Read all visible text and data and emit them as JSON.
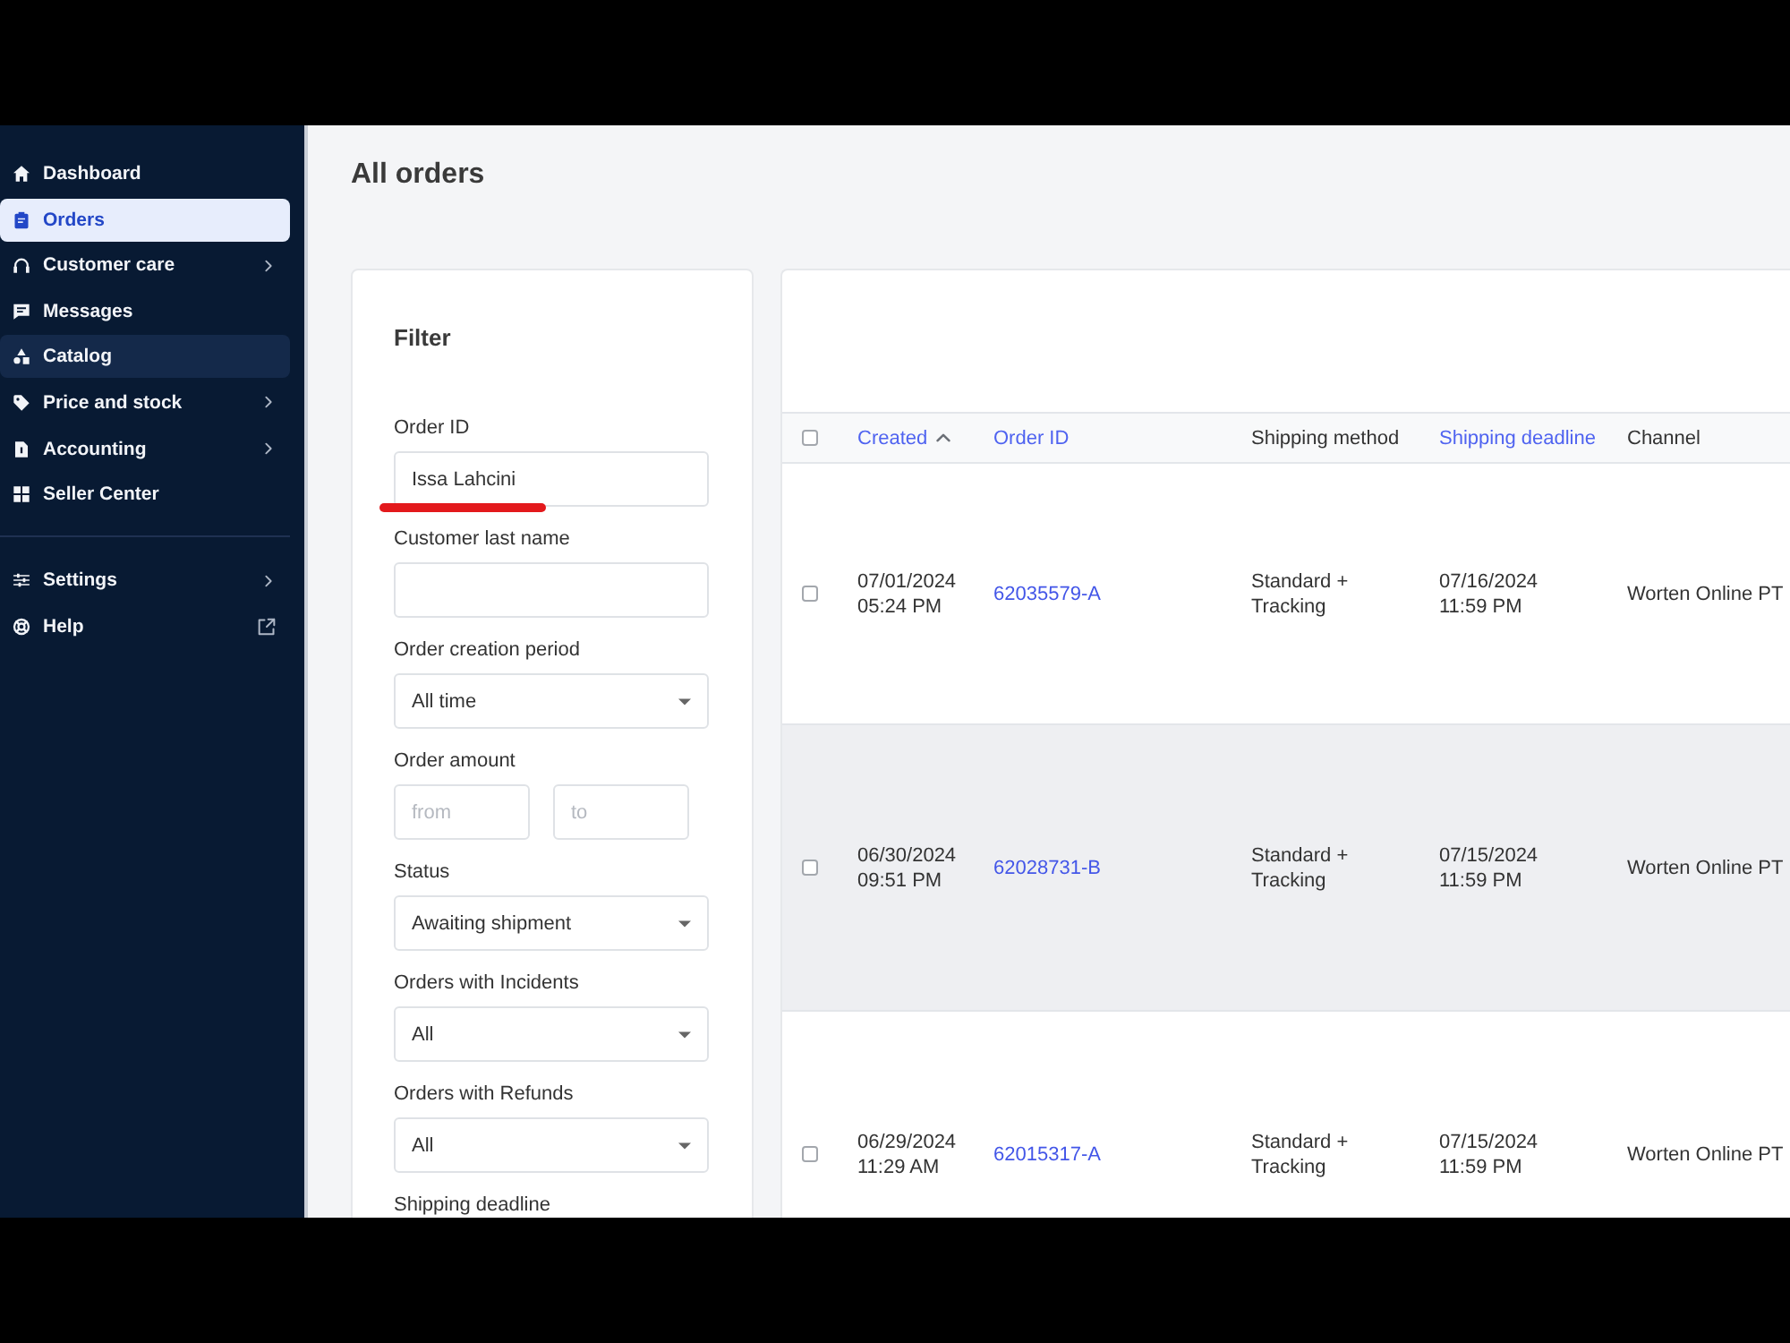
{
  "sidebar": {
    "groups": [
      {
        "items": [
          {
            "label": "Dashboard",
            "kind": "plain",
            "selected": false,
            "hovered": false
          },
          {
            "label": "Orders",
            "kind": "plain",
            "selected": true,
            "hovered": false
          },
          {
            "label": "Customer care",
            "kind": "submenu",
            "selected": false,
            "hovered": false
          },
          {
            "label": "Messages",
            "kind": "plain",
            "selected": false,
            "hovered": false
          },
          {
            "label": "Catalog",
            "kind": "plain",
            "selected": false,
            "hovered": true
          },
          {
            "label": "Price and stock",
            "kind": "submenu",
            "selected": false,
            "hovered": false
          },
          {
            "label": "Accounting",
            "kind": "submenu",
            "selected": false,
            "hovered": false
          },
          {
            "label": "Seller Center",
            "kind": "plain",
            "selected": false,
            "hovered": false
          }
        ]
      },
      {
        "items": [
          {
            "label": "Settings",
            "kind": "submenu",
            "selected": false,
            "hovered": false
          },
          {
            "label": "Help",
            "kind": "external",
            "selected": false,
            "hovered": false
          }
        ]
      }
    ]
  },
  "page_title": "All orders",
  "filter": {
    "title": "Filter",
    "fields": [
      {
        "kind": "text",
        "label": "Order ID",
        "value": "Issa Lahcini",
        "underlined": true
      },
      {
        "kind": "text",
        "label": "Customer last name"
      },
      {
        "kind": "select",
        "label": "Order creation period",
        "value": "All time"
      },
      {
        "kind": "range",
        "label": "Order amount",
        "inputs": [
          {
            "placeholder": "from"
          },
          {
            "placeholder": "to"
          }
        ]
      },
      {
        "kind": "select",
        "label": "Status",
        "value": "Awaiting shipment"
      },
      {
        "kind": "select",
        "label": "Orders with Incidents",
        "value": "All"
      },
      {
        "kind": "select",
        "label": "Orders with Refunds",
        "value": "All"
      },
      {
        "kind": "label",
        "label": "Shipping deadline"
      }
    ]
  },
  "table": {
    "select_all": {
      "checked": false
    },
    "columns": [
      {
        "label": "Created",
        "sortable": true,
        "sorted": true
      },
      {
        "label": "Order ID",
        "sortable": true,
        "sorted": false
      },
      {
        "label": "Shipping method",
        "sortable": false,
        "sorted": false
      },
      {
        "label": "Shipping deadline",
        "sortable": true,
        "sorted": false
      },
      {
        "label": "Channel",
        "sortable": false,
        "sorted": false
      }
    ],
    "rows": [
      {
        "checked": false,
        "hovered": false,
        "created": {
          "date": "07/01/2024",
          "time": "05:24 PM"
        },
        "order_id": "62035579-A",
        "shipping_method": "Standard + Tracking",
        "deadline": {
          "date": "07/16/2024",
          "time": "11:59 PM"
        },
        "channel": "Worten Online PT"
      },
      {
        "checked": false,
        "hovered": true,
        "created": {
          "date": "06/30/2024",
          "time": "09:51 PM"
        },
        "order_id": "62028731-B",
        "shipping_method": "Standard + Tracking",
        "deadline": {
          "date": "07/15/2024",
          "time": "11:59 PM"
        },
        "channel": "Worten Online PT"
      },
      {
        "checked": false,
        "hovered": false,
        "created": {
          "date": "06/29/2024",
          "time": "11:29 AM"
        },
        "order_id": "62015317-A",
        "shipping_method": "Standard + Tracking",
        "deadline": {
          "date": "07/15/2024",
          "time": "11:59 PM"
        },
        "channel": "Worten Online PT"
      }
    ]
  }
}
